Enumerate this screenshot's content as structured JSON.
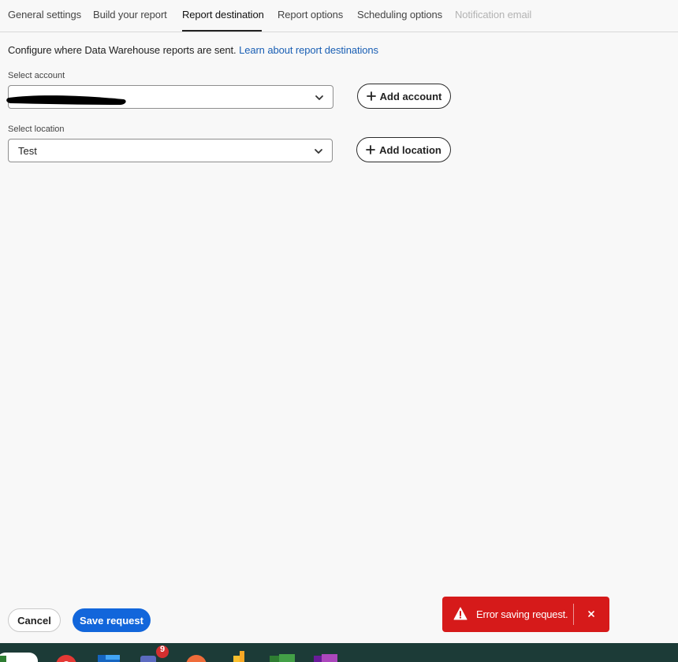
{
  "tabs": [
    {
      "label": "General settings",
      "state": "normal"
    },
    {
      "label": "Build your report",
      "state": "normal"
    },
    {
      "label": "Report destination",
      "state": "active"
    },
    {
      "label": "Report options",
      "state": "normal"
    },
    {
      "label": "Scheduling options",
      "state": "normal"
    },
    {
      "label": "Notification email",
      "state": "disabled"
    }
  ],
  "intro": {
    "text": "Configure where Data Warehouse reports are sent.",
    "link": "Learn about report destinations"
  },
  "account": {
    "label": "Select account",
    "value": "",
    "add_label": "Add account"
  },
  "location": {
    "label": "Select location",
    "value": "Test",
    "add_label": "Add location"
  },
  "footer": {
    "cancel_label": "Cancel",
    "save_label": "Save request"
  },
  "toast": {
    "message": "Error saving request.",
    "icon": "warning-icon",
    "close_icon": "close-icon"
  },
  "taskbar": {
    "badge_count": "9"
  },
  "colors": {
    "accent": "#1266db",
    "link": "#1a5fb4",
    "error": "#d61a1a",
    "taskbar": "#1c3b37"
  }
}
